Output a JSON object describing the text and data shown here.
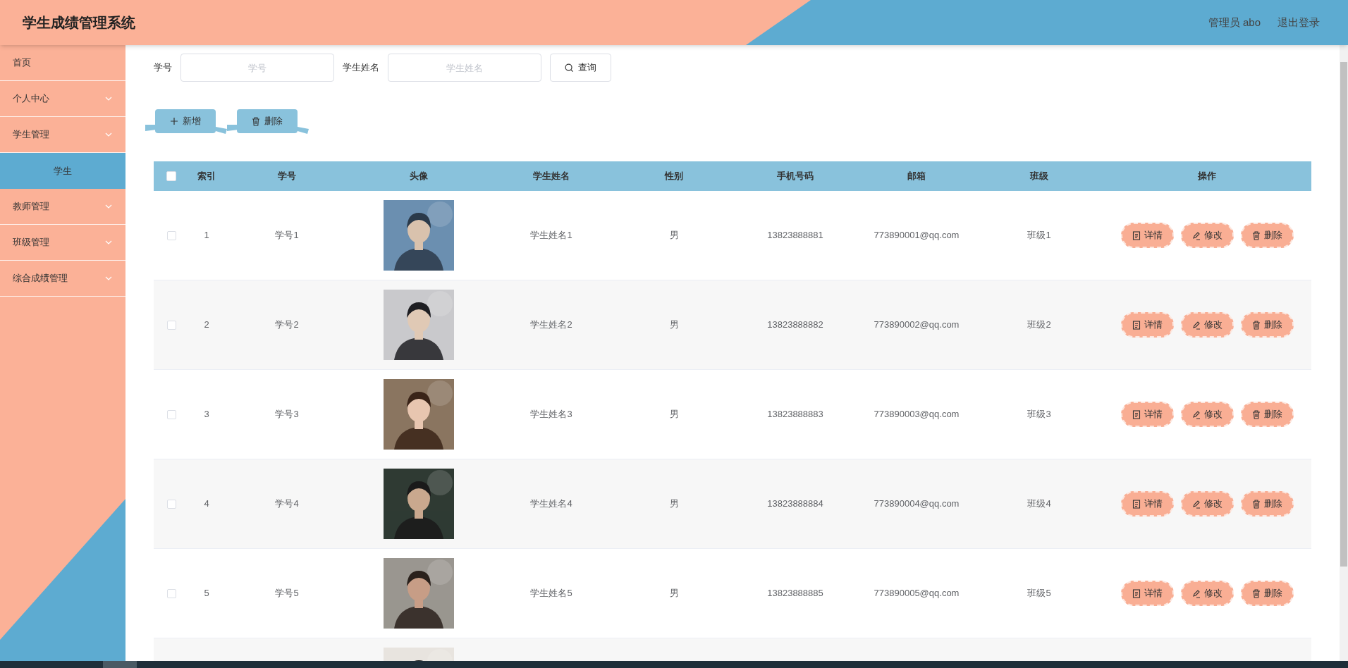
{
  "header": {
    "title": "学生成绩管理系统",
    "user": "管理员 abo",
    "logout": "退出登录"
  },
  "sidebar": {
    "items": [
      {
        "label": "首页",
        "kind": "link"
      },
      {
        "label": "个人中心",
        "kind": "submenu"
      },
      {
        "label": "学生管理",
        "kind": "submenu",
        "children": [
          {
            "label": "学生",
            "selected": true
          }
        ]
      },
      {
        "label": "教师管理",
        "kind": "submenu"
      },
      {
        "label": "班级管理",
        "kind": "submenu"
      },
      {
        "label": "综合成绩管理",
        "kind": "submenu"
      }
    ]
  },
  "search": {
    "fields": [
      {
        "label": "学号",
        "placeholder": "学号"
      },
      {
        "label": "学生姓名",
        "placeholder": "学生姓名"
      }
    ],
    "button": "查询"
  },
  "toolbar": [
    {
      "kind": "add",
      "label": "新增"
    },
    {
      "kind": "delete",
      "label": "删除"
    }
  ],
  "table": {
    "select_all_checked": false,
    "columns": [
      "索引",
      "学号",
      "头像",
      "学生姓名",
      "性别",
      "手机号码",
      "邮箱",
      "班级",
      "操作"
    ],
    "rows": [
      {
        "index": "1",
        "id": "学号1",
        "avatar": {
          "kind": "picture"
        },
        "name": "学生姓名1",
        "gender": "男",
        "phone": "13823888881",
        "email": "773890001@qq.com",
        "class": "班级1",
        "checked": false,
        "actions": [
          {
            "kind": "detail",
            "label": "详情"
          },
          {
            "kind": "edit",
            "label": "修改"
          },
          {
            "kind": "delete",
            "label": "删除"
          }
        ]
      },
      {
        "index": "2",
        "id": "学号2",
        "avatar": {
          "kind": "picture"
        },
        "name": "学生姓名2",
        "gender": "男",
        "phone": "13823888882",
        "email": "773890002@qq.com",
        "class": "班级2",
        "checked": false,
        "actions": [
          {
            "kind": "detail",
            "label": "详情"
          },
          {
            "kind": "edit",
            "label": "修改"
          },
          {
            "kind": "delete",
            "label": "删除"
          }
        ]
      },
      {
        "index": "3",
        "id": "学号3",
        "avatar": {
          "kind": "picture"
        },
        "name": "学生姓名3",
        "gender": "男",
        "phone": "13823888883",
        "email": "773890003@qq.com",
        "class": "班级3",
        "checked": false,
        "actions": [
          {
            "kind": "detail",
            "label": "详情"
          },
          {
            "kind": "edit",
            "label": "修改"
          },
          {
            "kind": "delete",
            "label": "删除"
          }
        ]
      },
      {
        "index": "4",
        "id": "学号4",
        "avatar": {
          "kind": "picture"
        },
        "name": "学生姓名4",
        "gender": "男",
        "phone": "13823888884",
        "email": "773890004@qq.com",
        "class": "班级4",
        "checked": false,
        "actions": [
          {
            "kind": "detail",
            "label": "详情"
          },
          {
            "kind": "edit",
            "label": "修改"
          },
          {
            "kind": "delete",
            "label": "删除"
          }
        ]
      },
      {
        "index": "5",
        "id": "学号5",
        "avatar": {
          "kind": "picture"
        },
        "name": "学生姓名5",
        "gender": "男",
        "phone": "13823888885",
        "email": "773890005@qq.com",
        "class": "班级5",
        "checked": false,
        "actions": [
          {
            "kind": "detail",
            "label": "详情"
          },
          {
            "kind": "edit",
            "label": "修改"
          },
          {
            "kind": "delete",
            "label": "删除"
          }
        ]
      },
      {
        "avatar": {
          "kind": "picture"
        }
      }
    ]
  }
}
